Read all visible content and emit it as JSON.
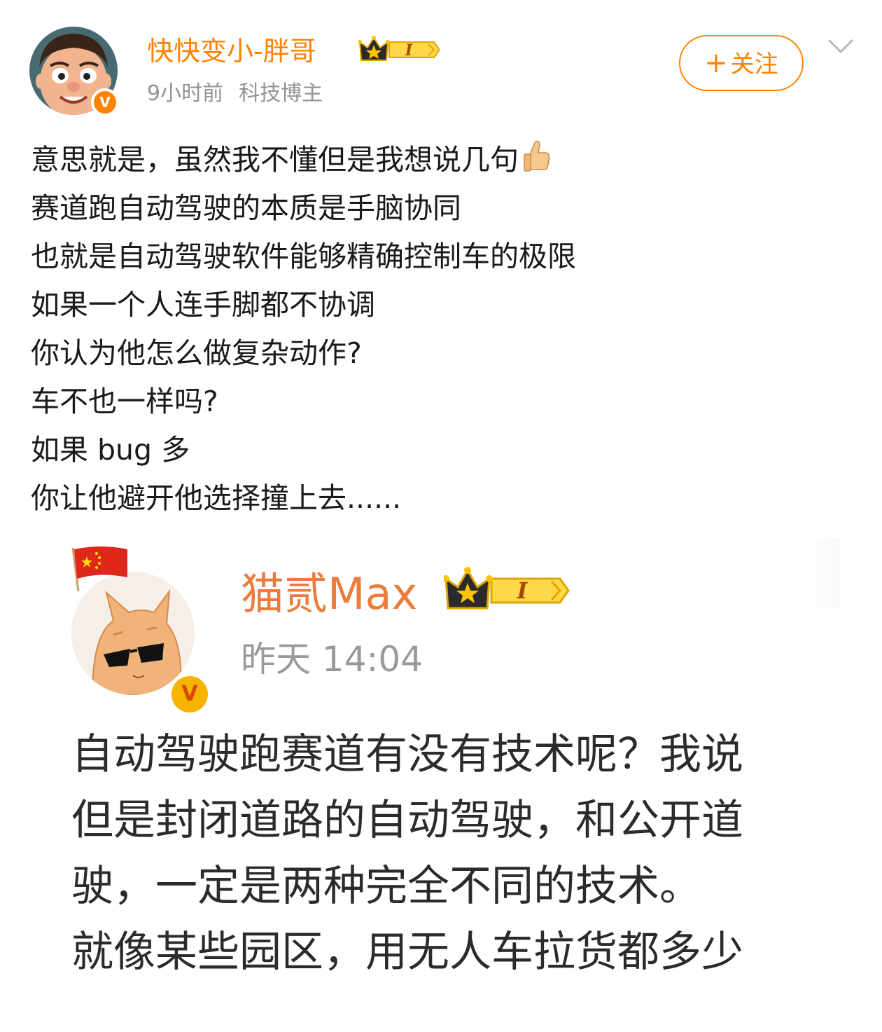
{
  "author": {
    "name": "快快变小-胖哥",
    "level_badge": "I",
    "time": "9小时前",
    "tag": "科技博主",
    "verified_badge": "V"
  },
  "actions": {
    "follow_label": "关注",
    "follow_plus": "+"
  },
  "post": {
    "lines": [
      "意思就是，虽然我不懂但是我想说几句",
      "赛道跑自动驾驶的本质是手脑协同",
      "也就是自动驾驶软件能够精确控制车的极限",
      "如果一个人连手脚都不协调",
      "你认为他怎么做复杂动作?",
      "车不也一样吗?",
      "如果 bug 多",
      "你让他避开他选择撞上去......"
    ],
    "thumbs_emoji": "👍"
  },
  "quoted": {
    "name": "猫贰Max",
    "level_badge": "I",
    "time": "昨天 14:04",
    "verified_badge": "V",
    "lines": [
      "自动驾驶跑赛道有没有技术呢？我说",
      "但是封闭道路的自动驾驶，和公开道",
      "驶，一定是两种完全不同的技术。",
      "就像某些园区，用无人车拉货都多少"
    ]
  },
  "colors": {
    "accent": "#ff8200",
    "quoted_name": "#ec7b3c",
    "meta_gray": "#939393",
    "text": "#1a1a1a"
  },
  "icons": {
    "avatar": "cartoon-man-avatar",
    "verified": "verified-v-icon",
    "crown": "crown-level-badge",
    "chevron": "chevron-down-icon",
    "flag": "china-flag-icon",
    "quoted_avatar": "cat-sunglasses-avatar"
  }
}
